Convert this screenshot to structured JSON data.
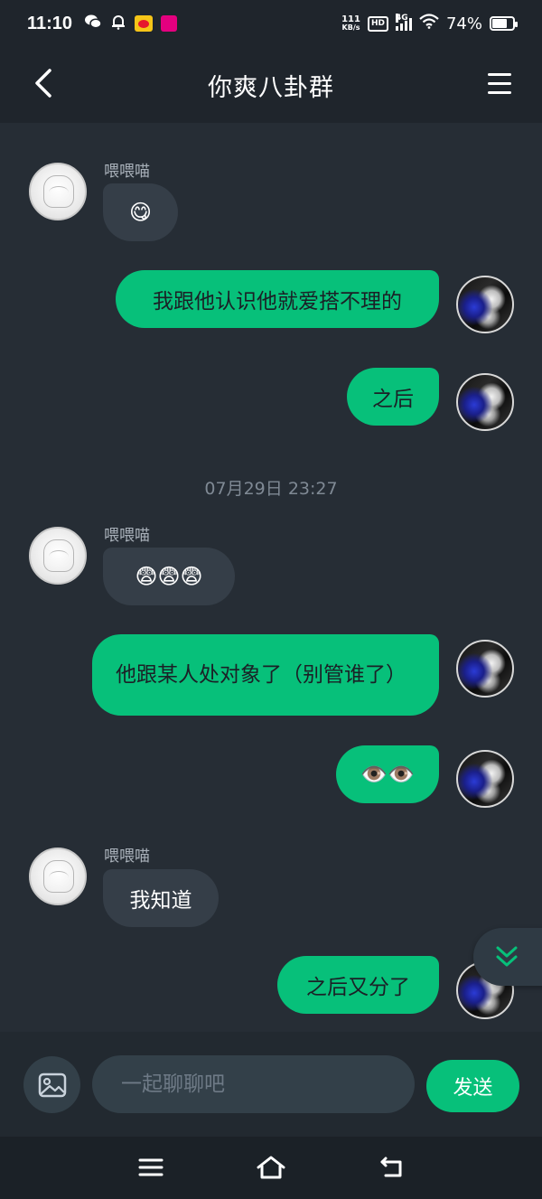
{
  "status_bar": {
    "time": "11:10",
    "net_speed_value": "111",
    "net_speed_unit": "KB/s",
    "hd_label": "HD",
    "network_label": "4G",
    "battery": "74%",
    "battery_level": 0.74,
    "icons": [
      "wechat-icon",
      "notification-bell-icon",
      "weibo-icon",
      "app-badge-icon",
      "wifi-icon",
      "battery-icon"
    ]
  },
  "header": {
    "title": "你爽八卦群",
    "back_icon": "chevron-left-icon",
    "menu_icon": "hamburger-menu-icon"
  },
  "messages": [
    {
      "sender": "other",
      "name": "喂喂喵",
      "text": "😋"
    },
    {
      "sender": "self",
      "text": "我跟他认识他就爱搭不理的"
    },
    {
      "sender": "self",
      "text": "之后"
    },
    {
      "type": "timestamp",
      "text": "07月29日 23:27"
    },
    {
      "sender": "other",
      "name": "喂喂喵",
      "text": "😨😨😨"
    },
    {
      "sender": "self",
      "text": "他跟某人处对象了（别管谁了）"
    },
    {
      "sender": "self",
      "text": "👁️👁️"
    },
    {
      "sender": "other",
      "name": "喂喂喵",
      "text": "我知道"
    },
    {
      "sender": "self",
      "text": "之后又分了"
    }
  ],
  "input_bar": {
    "image_icon": "image-icon",
    "placeholder": "一起聊聊吧",
    "value": "",
    "send_label": "发送"
  },
  "scroll_button_icon": "double-chevron-down-icon",
  "nav_bar": {
    "icons": [
      "menu-icon",
      "home-icon",
      "back-icon"
    ]
  },
  "colors": {
    "background": "#262d35",
    "header": "#1f252c",
    "accent_green": "#07c07a",
    "bubble_other": "#353e48",
    "input_bg": "#334049"
  }
}
